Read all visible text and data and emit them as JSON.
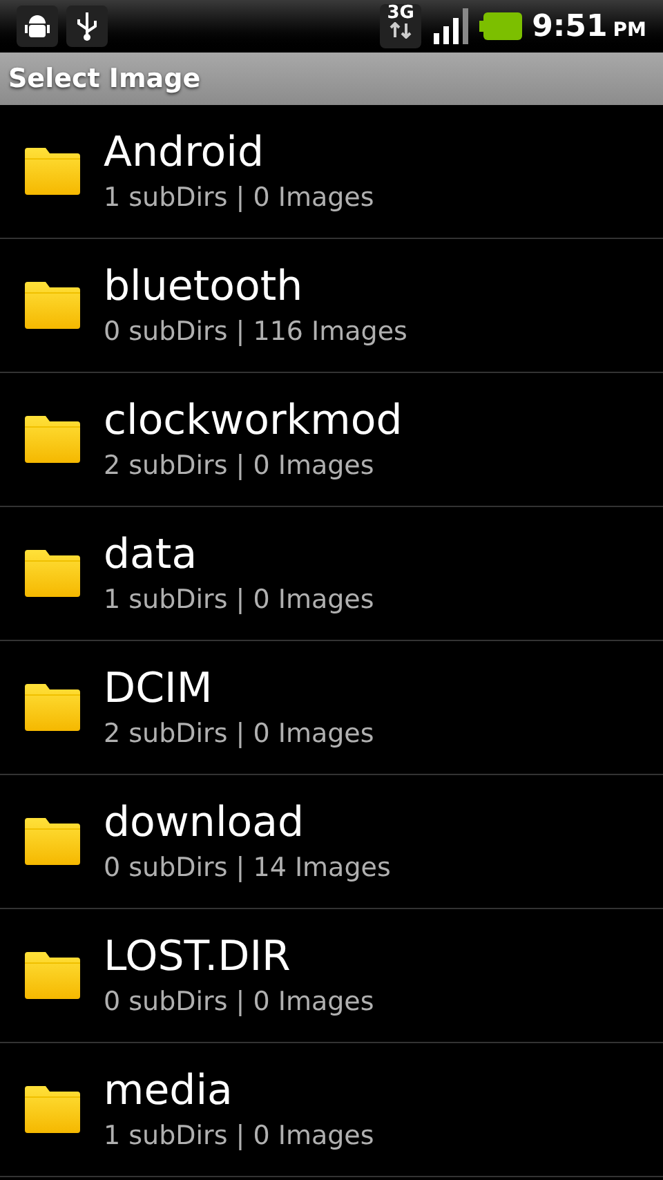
{
  "status_bar": {
    "network": "3G",
    "time": "9:51",
    "meridiem": "PM"
  },
  "title": "Select Image",
  "folders": [
    {
      "name": "Android",
      "info": "1 subDirs | 0 Images"
    },
    {
      "name": "bluetooth",
      "info": "0 subDirs | 116 Images"
    },
    {
      "name": "clockworkmod",
      "info": "2 subDirs | 0 Images"
    },
    {
      "name": "data",
      "info": "1 subDirs | 0 Images"
    },
    {
      "name": "DCIM",
      "info": "2 subDirs | 0 Images"
    },
    {
      "name": "download",
      "info": "0 subDirs | 14 Images"
    },
    {
      "name": "LOST.DIR",
      "info": "0 subDirs | 0 Images"
    },
    {
      "name": "media",
      "info": "1 subDirs | 0 Images"
    }
  ]
}
